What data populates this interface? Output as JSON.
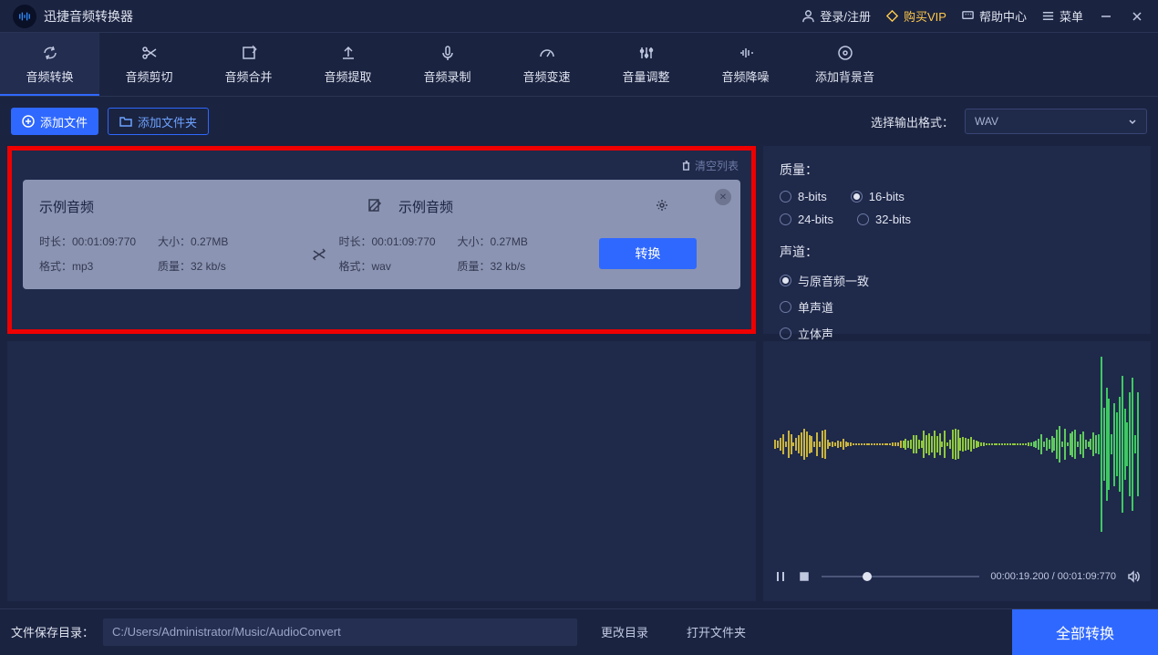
{
  "app_title": "迅捷音频转换器",
  "titlebar": {
    "login": "登录/注册",
    "vip": "购买VIP",
    "help": "帮助中心",
    "menu": "菜单"
  },
  "nav": [
    {
      "label": "音频转换",
      "icon": "refresh"
    },
    {
      "label": "音频剪切",
      "icon": "scissors"
    },
    {
      "label": "音频合并",
      "icon": "merge"
    },
    {
      "label": "音频提取",
      "icon": "upload"
    },
    {
      "label": "音频录制",
      "icon": "mic"
    },
    {
      "label": "音频变速",
      "icon": "speed"
    },
    {
      "label": "音量调整",
      "icon": "eq"
    },
    {
      "label": "音频降噪",
      "icon": "noise"
    },
    {
      "label": "添加背景音",
      "icon": "bgm"
    }
  ],
  "toolbar": {
    "add_file": "添加文件",
    "add_folder": "添加文件夹",
    "format_label": "选择输出格式：",
    "format_value": "WAV"
  },
  "list": {
    "clear": "清空列表"
  },
  "card": {
    "src_name": "示例音频",
    "dst_name": "示例音频",
    "src_duration": "时长：00:01:09:770",
    "src_size": "大小：0.27MB",
    "src_format": "格式：mp3",
    "src_bitrate": "质量：32 kb/s",
    "dst_duration": "时长：00:01:09:770",
    "dst_size": "大小：0.27MB",
    "dst_format": "格式：wav",
    "dst_bitrate": "质量：32 kb/s",
    "convert": "转换"
  },
  "settings": {
    "quality_label": "质量：",
    "quality_opts": [
      "8-bits",
      "16-bits",
      "24-bits",
      "32-bits"
    ],
    "quality_selected": "16-bits",
    "channel_label": "声道：",
    "channel_opts": [
      "与原音频一致",
      "单声道",
      "立体声"
    ],
    "channel_selected": "与原音频一致"
  },
  "playback": {
    "current": "00:00:19.200",
    "total": "00:01:09:770"
  },
  "footer": {
    "label": "文件保存目录：",
    "path": "C:/Users/Administrator/Music/AudioConvert",
    "change": "更改目录",
    "open": "打开文件夹",
    "convert_all": "全部转换"
  }
}
